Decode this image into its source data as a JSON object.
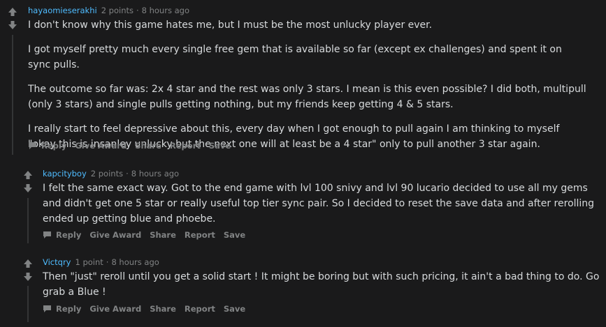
{
  "icons": {
    "upvote": "arrow-up-icon",
    "downvote": "arrow-down-icon",
    "reply": "comment-bubble-icon"
  },
  "colors": {
    "background": "#1a1a1b",
    "text": "#d7dadc",
    "muted": "#818384",
    "author": "#4fbcff",
    "thread_line": "#343536"
  },
  "comments": [
    {
      "author": "hayaomieserakhi",
      "points": "2 points",
      "dot": "·",
      "time": "8 hours ago",
      "paragraphs": [
        "I don't know why this game hates me, but I must be the most unlucky player ever.",
        "I got myself pretty much every single free gem that is available so far (except ex challenges) and spent it on sync pulls.",
        "The outcome so far was: 2x 4 star and the rest was only 3 stars. I mean is this even possible? I did both, multipull (only 3 stars) and single pulls getting nothing, but my friends keep getting 4 & 5 stars.",
        "I really start to feel depressive about this, every day when I got enough to pull again I am thinking to myself \"okay this is insanley unlucky but the next one will at least be a 4 star\" only to pull another 3 star again."
      ],
      "actions": [
        "Reply",
        "Give Award",
        "Share",
        "Report",
        "Save"
      ]
    },
    {
      "author": "kapcityboy",
      "points": "2 points",
      "dot": "·",
      "time": "8 hours ago",
      "paragraphs": [
        "I felt the same exact way. Got to the end game with lvl 100 snivy and lvl 90 lucario decided to use all my gems and didn't get one 5 star or really useful top tier sync pair. So I decided to reset the save data and after rerolling ended up getting blue and phoebe."
      ],
      "actions": [
        "Reply",
        "Give Award",
        "Share",
        "Report",
        "Save"
      ]
    },
    {
      "author": "Victqry",
      "points": "1 point",
      "dot": "·",
      "time": "8 hours ago",
      "paragraphs": [
        "Then \"just\" reroll until you get a solid start ! It might be boring but with such pricing, it ain't a bad thing to do. Go grab a Blue !"
      ],
      "actions": [
        "Reply",
        "Give Award",
        "Share",
        "Report",
        "Save"
      ]
    }
  ]
}
